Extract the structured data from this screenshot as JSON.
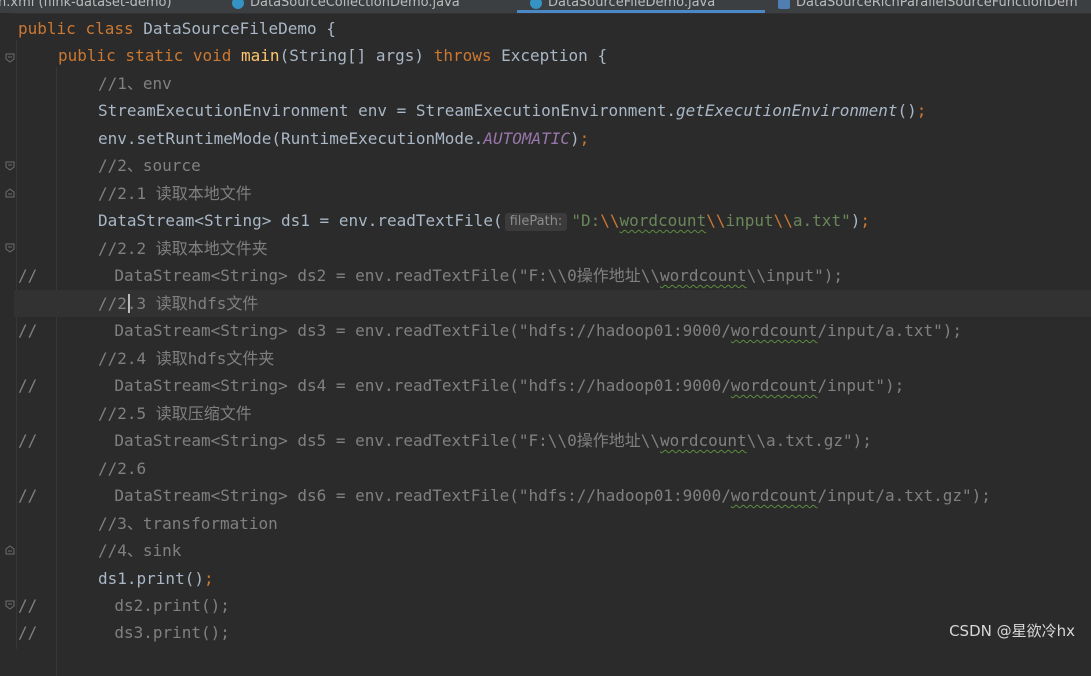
{
  "tabs": [
    {
      "label": "n.xml (flink-dataset-demo)"
    },
    {
      "label": "DataSourceCollectionDemo.java"
    },
    {
      "label": "DataSourceFileDemo.java"
    },
    {
      "label": "DataSourceRichParallelSourceFunctionDem"
    }
  ],
  "code": {
    "l1_kw1": "public",
    "l1_kw2": "class",
    "l1_name": "DataSourceFileDemo {",
    "l2_kw": "public static void",
    "l2_method": "main",
    "l2_args": "(String[] args) ",
    "l2_throws": "throws",
    "l2_rest": " Exception {",
    "l3": "//1、env",
    "l4_a": "StreamExecutionEnvironment env = StreamExecutionEnvironment.",
    "l4_b": "getExecutionEnvironment",
    "l4_c": "()",
    "l4_semi": ";",
    "l5_a": "env.setRuntimeMode(RuntimeExecutionMode.",
    "l5_b": "AUTOMATIC",
    "l5_c": ")",
    "l6": "//2、source",
    "l7": "//2.1 读取本地文件",
    "l8_a": "DataStream<String> ds1 = env.readTextFile(",
    "l8_hint": "filePath:",
    "l8_s1": "\"D:",
    "l8_e1": "\\\\",
    "l8_s2": "wordcount",
    "l8_e2": "\\\\",
    "l8_s3": "input",
    "l8_e3": "\\\\",
    "l8_s4": "a.txt\"",
    "l8_end": ")",
    "l9": "//2.2 读取本地文件夹",
    "l10_a": "//        DataStream<String> ds2 = env.readTextFile(\"F:\\\\0操作地址\\\\",
    "l10_u": "wordcount",
    "l10_b": "\\\\input\");",
    "l11_a": "//2",
    "l11_b": ".3 读取hdfs文件",
    "l12_a": "//        DataStream<String> ds3 = env.readTextFile(\"hdfs://hadoop01:9000/",
    "l12_u": "wordcount",
    "l12_b": "/input/a.txt\");",
    "l13": "//2.4 读取hdfs文件夹",
    "l14_a": "//        DataStream<String> ds4 = env.readTextFile(\"hdfs://hadoop01:9000/",
    "l14_u": "wordcount",
    "l14_b": "/input\");",
    "l15": "//2.5 读取压缩文件",
    "l16_a": "//        DataStream<String> ds5 = env.readTextFile(\"F:\\\\0操作地址\\\\",
    "l16_u": "wordcount",
    "l16_b": "\\\\a.txt.gz\");",
    "l17": "//2.6",
    "l18_a": "//        DataStream<String> ds6 = env.readTextFile(\"hdfs://hadoop01:9000/",
    "l18_u": "wordcount",
    "l18_b": "/input/a.txt.gz\");",
    "l19": "//3、transformation",
    "l20": "//4、sink",
    "l21_a": "ds1.print()",
    "l22": "//        ds2.print();",
    "l23": "//        ds3.print();"
  },
  "watermark": "CSDN @星欲冷hx",
  "colors": {
    "background": "#2b2b2b",
    "keyword": "#cc7832",
    "method": "#ffc66d",
    "comment": "#808080",
    "string": "#6a8759",
    "static_field": "#9876aa",
    "tab_underline": "#4a88c7"
  }
}
